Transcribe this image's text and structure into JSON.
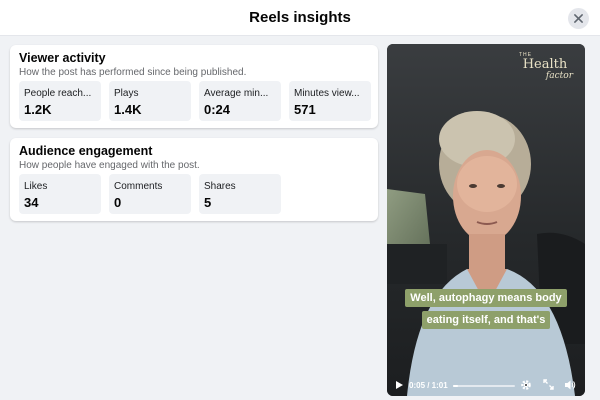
{
  "dialog": {
    "title": "Reels insights"
  },
  "viewer_activity": {
    "title": "Viewer activity",
    "subtitle": "How the post has performed since being published.",
    "metrics": [
      {
        "label": "People reach...",
        "value": "1.2K"
      },
      {
        "label": "Plays",
        "value": "1.4K"
      },
      {
        "label": "Average min...",
        "value": "0:24"
      },
      {
        "label": "Minutes view...",
        "value": "571"
      }
    ]
  },
  "audience_engagement": {
    "title": "Audience engagement",
    "subtitle": "How people have engaged with the post.",
    "metrics": [
      {
        "label": "Likes",
        "value": "34"
      },
      {
        "label": "Comments",
        "value": "0"
      },
      {
        "label": "Shares",
        "value": "5"
      }
    ]
  },
  "video": {
    "brand": {
      "small": "THE",
      "main": "Health",
      "script": "factor"
    },
    "captions": [
      "Well, autophagy means body",
      "eating itself, and that's"
    ],
    "time": "0:05 / 1:01",
    "progress_fraction": 0.08,
    "caption_color": "#8ea06a"
  },
  "icons": {
    "close": "close-icon",
    "play": "play-icon",
    "settings": "gear-icon",
    "fullscreen": "expand-icon",
    "volume": "volume-icon"
  }
}
